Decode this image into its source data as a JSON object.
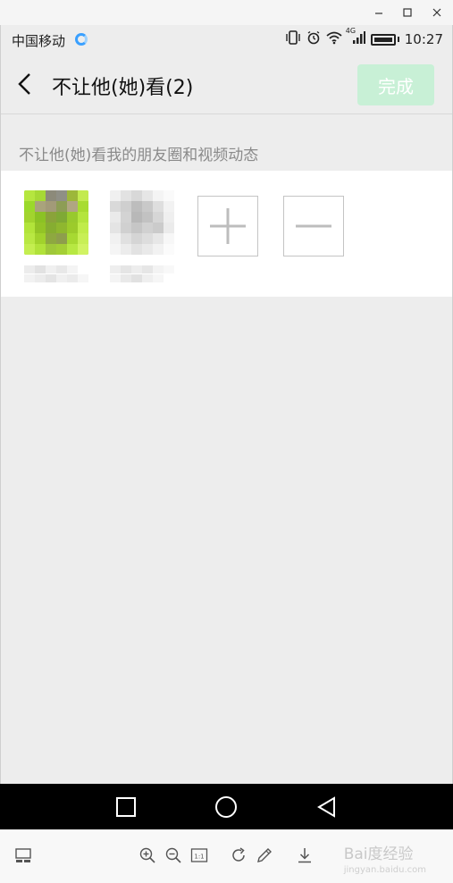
{
  "window": {
    "minimize_icon": "minimize-icon",
    "maximize_icon": "maximize-icon",
    "close_icon": "close-icon"
  },
  "status_bar": {
    "carrier": "中国移动",
    "network": "4G",
    "time": "10:27"
  },
  "header": {
    "title": "不让他(她)看(2)",
    "done_label": "完成",
    "colors": {
      "done_bg": "#c8f0d6",
      "done_text": "#ffffff"
    }
  },
  "section": {
    "hint": "不让他(她)看我的朋友圈和视频动态"
  },
  "members": [
    {
      "id": "contact-1",
      "avatar_color": "#9bd92a"
    },
    {
      "id": "contact-2",
      "avatar_color": "#c8c8c8"
    }
  ],
  "actions": {
    "add_icon": "plus-icon",
    "remove_icon": "minus-icon"
  },
  "watermark": {
    "brand": "Bai度经验",
    "sub": "jingyan.baidu.com"
  }
}
